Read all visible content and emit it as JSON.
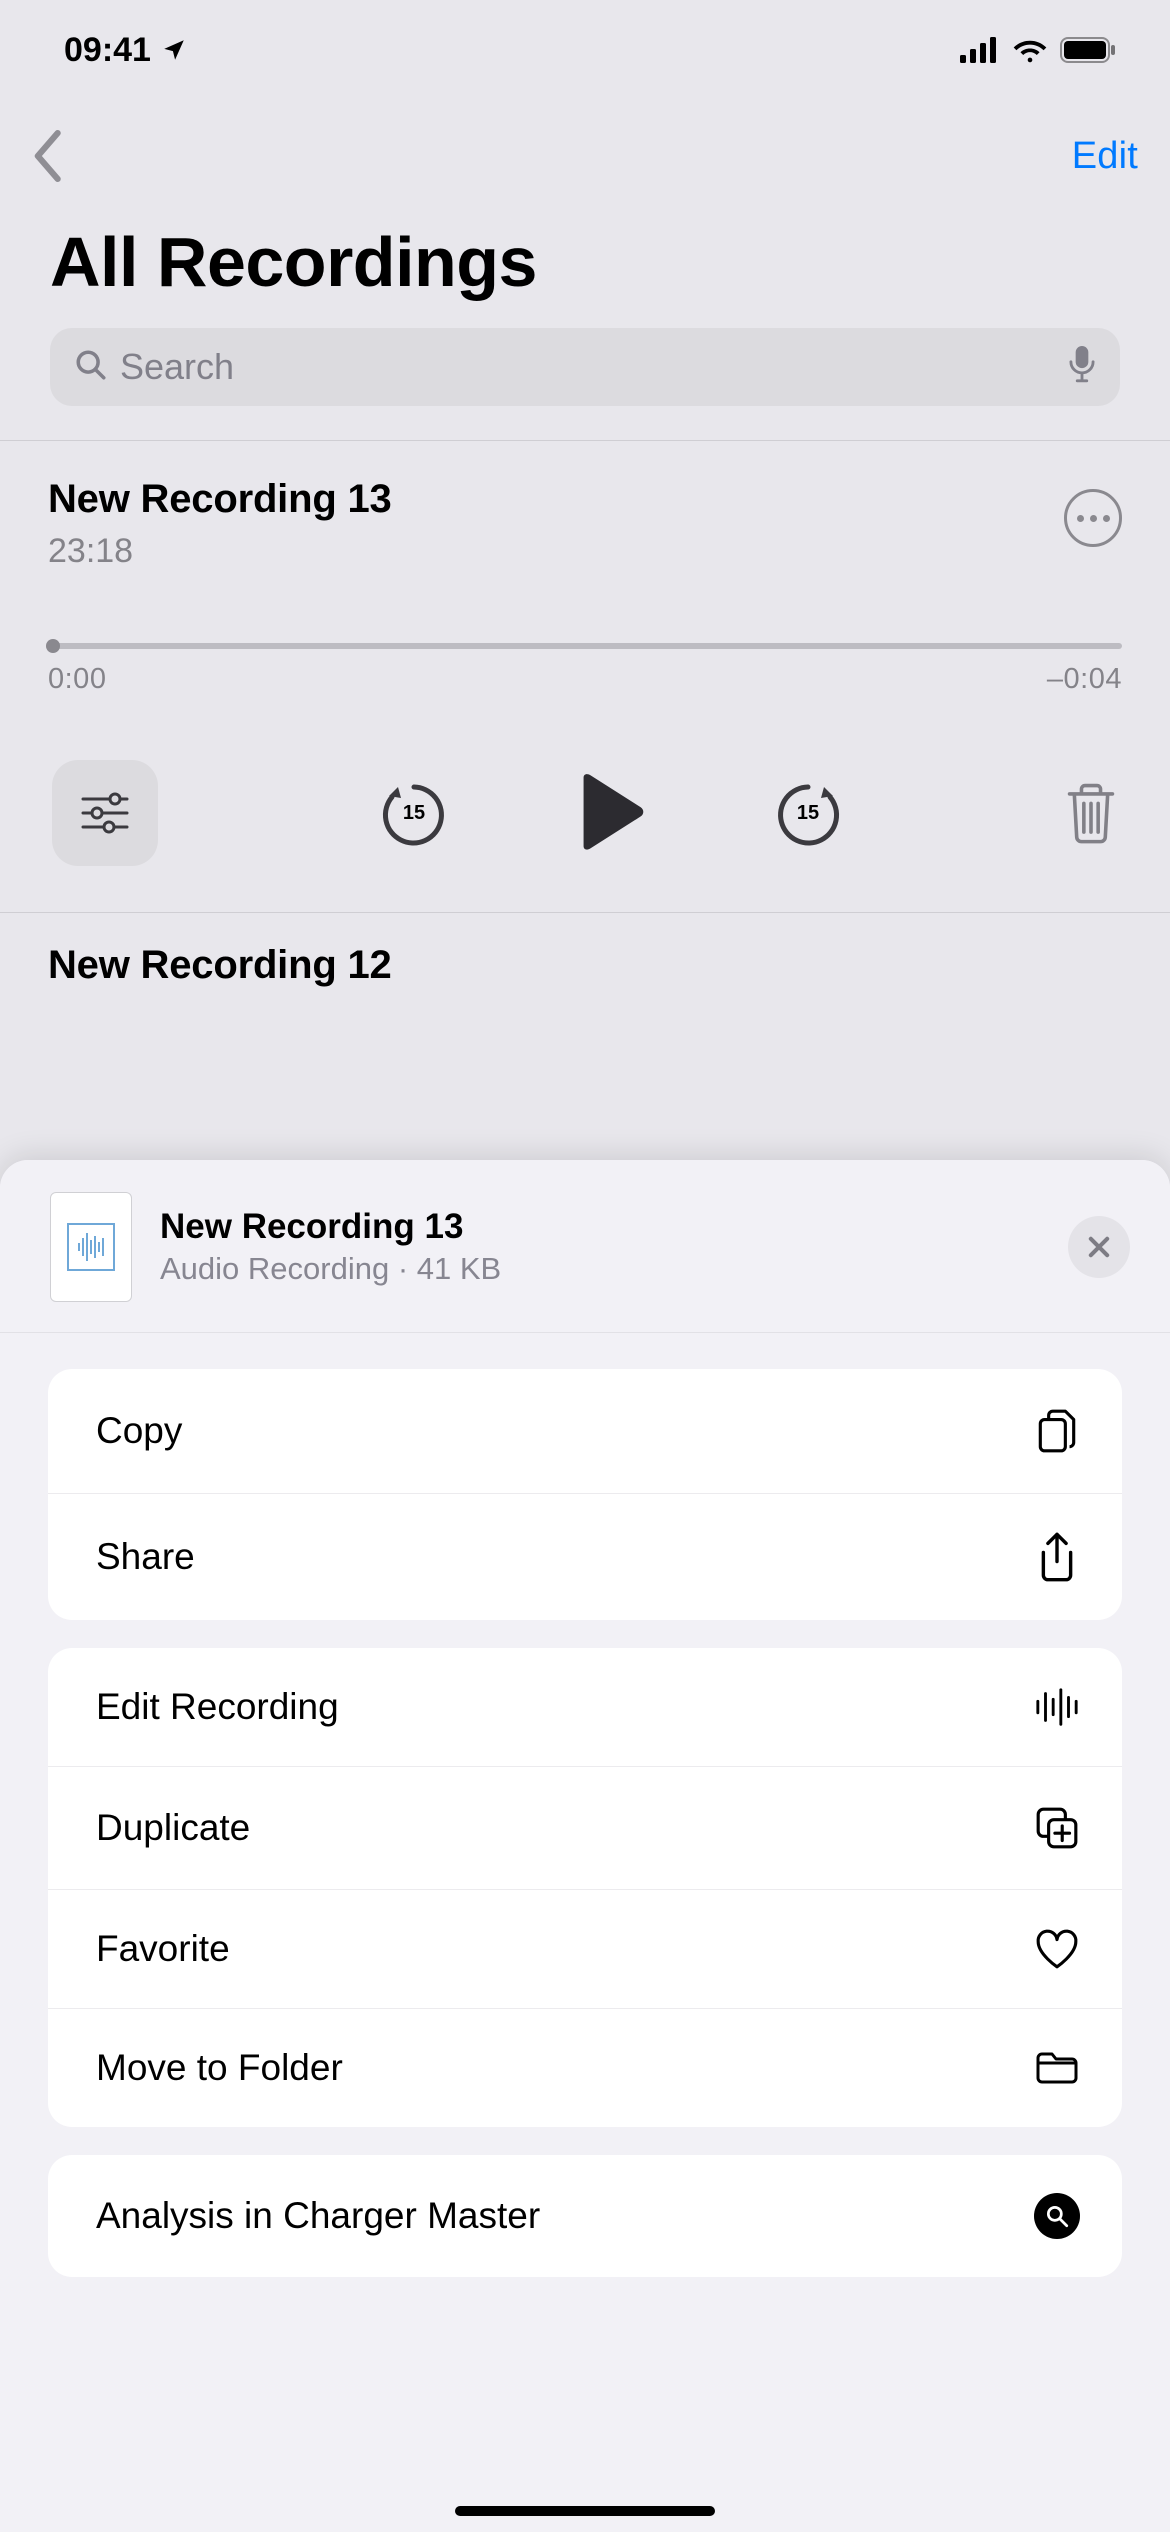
{
  "status": {
    "time": "09:41"
  },
  "nav": {
    "edit_label": "Edit"
  },
  "page": {
    "title": "All Recordings"
  },
  "search": {
    "placeholder": "Search"
  },
  "current_recording": {
    "title": "New Recording 13",
    "time": "23:18",
    "elapsed": "0:00",
    "remaining": "–0:04",
    "skip_amount": "15"
  },
  "next_recording": {
    "title": "New Recording 12"
  },
  "sheet": {
    "title": "New Recording 13",
    "subtitle": "Audio Recording · 41 KB",
    "menu": {
      "copy": "Copy",
      "share": "Share",
      "edit": "Edit Recording",
      "duplicate": "Duplicate",
      "favorite": "Favorite",
      "move": "Move to Folder",
      "analysis": "Analysis in Charger Master"
    }
  }
}
